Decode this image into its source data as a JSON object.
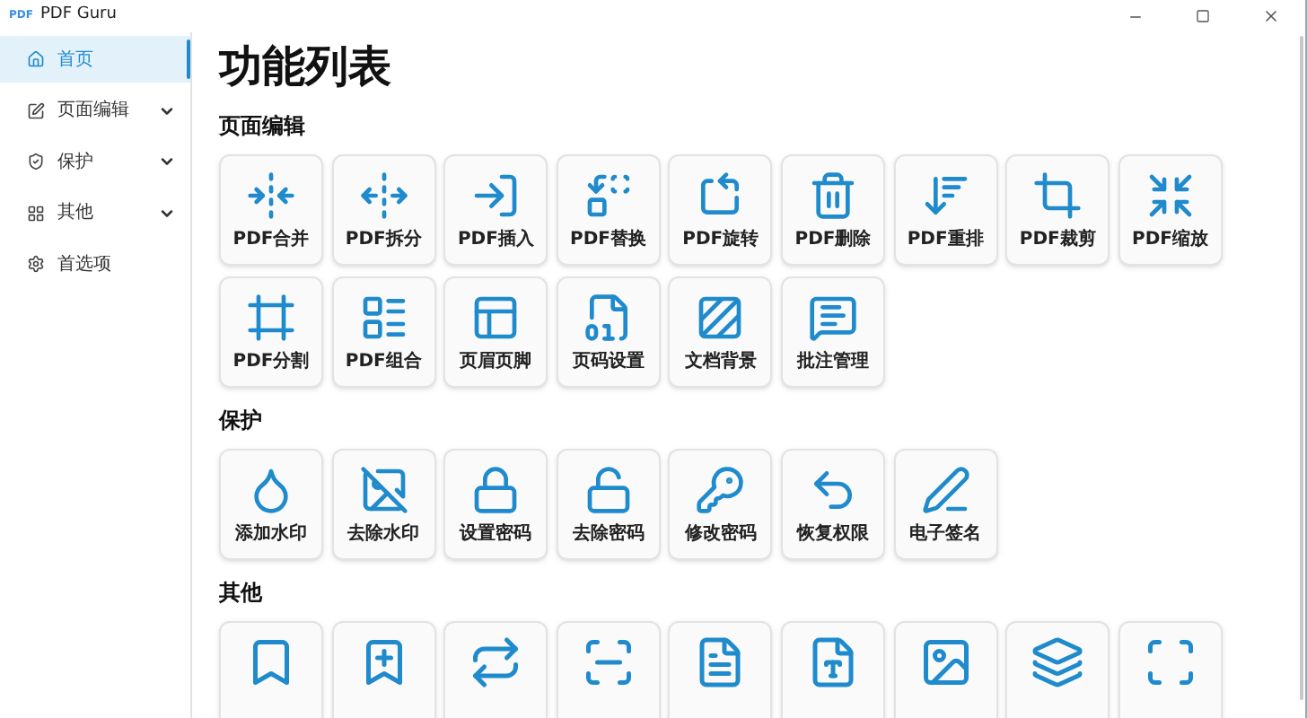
{
  "window": {
    "logo": "PDF",
    "title": "PDF Guru"
  },
  "sidebar": {
    "items": [
      {
        "label": "首页",
        "selected": true
      },
      {
        "label": "页面编辑",
        "selected": false,
        "expanded": false
      },
      {
        "label": "保护",
        "selected": false,
        "expanded": false
      },
      {
        "label": "其他",
        "selected": false,
        "expanded": false
      },
      {
        "label": "首选项",
        "selected": false
      }
    ]
  },
  "heading": "功能列表",
  "sections": [
    {
      "title": "页面编辑",
      "tiles": [
        {
          "kind": "labeled",
          "label": "PDF合并"
        },
        {
          "kind": "labeled",
          "label": "PDF拆分"
        },
        {
          "kind": "labeled",
          "label": "PDF插入"
        },
        {
          "kind": "labeled",
          "label": "PDF替换"
        },
        {
          "kind": "labeled",
          "label": "PDF旋转"
        },
        {
          "kind": "labeled",
          "label": "PDF删除"
        },
        {
          "kind": "labeled",
          "label": "PDF重排"
        },
        {
          "kind": "labeled",
          "label": "PDF裁剪"
        },
        {
          "kind": "labeled",
          "label": "PDF缩放"
        },
        {
          "kind": "labeled",
          "label": "PDF分割"
        },
        {
          "kind": "labeled",
          "label": "PDF组合"
        },
        {
          "kind": "labeled",
          "label": "页眉页脚"
        },
        {
          "kind": "labeled",
          "label": "页码设置"
        },
        {
          "kind": "labeled",
          "label": "文档背景"
        },
        {
          "kind": "labeled",
          "label": "批注管理"
        }
      ]
    },
    {
      "title": "保护",
      "tiles": [
        {
          "kind": "labeled",
          "label": "添加水印"
        },
        {
          "kind": "labeled",
          "label": "去除水印"
        },
        {
          "kind": "labeled",
          "label": "设置密码"
        },
        {
          "kind": "labeled",
          "label": "去除密码"
        },
        {
          "kind": "labeled",
          "label": "修改密码"
        },
        {
          "kind": "labeled",
          "label": "恢复权限"
        },
        {
          "kind": "labeled",
          "label": "电子签名"
        }
      ]
    },
    {
      "title": "其他",
      "tiles": [
        {
          "kind": "icon"
        },
        {
          "kind": "icon"
        },
        {
          "kind": "icon"
        },
        {
          "kind": "icon"
        },
        {
          "kind": "icon"
        },
        {
          "kind": "icon"
        },
        {
          "kind": "icon"
        },
        {
          "kind": "icon"
        },
        {
          "kind": "icon"
        }
      ]
    }
  ]
}
